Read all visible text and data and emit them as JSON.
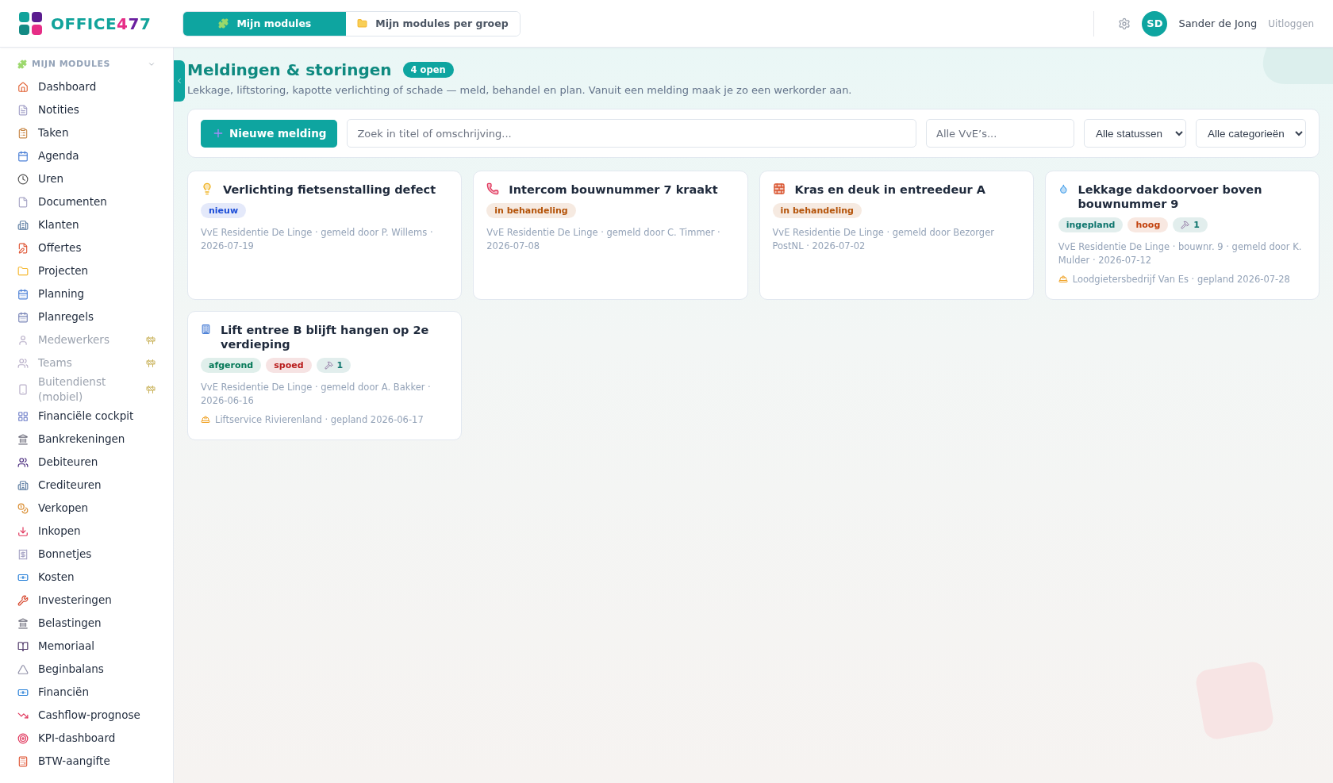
{
  "header": {
    "logo": {
      "parts": [
        {
          "text": "OFFICE",
          "color": "#12a39b"
        },
        {
          "text": "4",
          "color": "#e62d86"
        },
        {
          "text": "7",
          "color": "#6a1fa0"
        },
        {
          "text": "7",
          "color": "#12a39b"
        }
      ]
    },
    "tabs": [
      {
        "label": "Mijn modules",
        "selected": true
      },
      {
        "label": "Mijn modules per groep",
        "selected": false
      }
    ],
    "user": {
      "initials": "SD",
      "name": "Sander de Jong",
      "logout": "Uitloggen"
    }
  },
  "sidebar": {
    "section": "MIJN MODULES",
    "items": [
      {
        "label": "Dashboard",
        "disabled": false
      },
      {
        "label": "Notities",
        "disabled": false
      },
      {
        "label": "Taken",
        "disabled": false
      },
      {
        "label": "Agenda",
        "disabled": false
      },
      {
        "label": "Uren",
        "disabled": false
      },
      {
        "label": "Documenten",
        "disabled": false
      },
      {
        "label": "Klanten",
        "disabled": false
      },
      {
        "label": "Offertes",
        "disabled": false
      },
      {
        "label": "Projecten",
        "disabled": false
      },
      {
        "label": "Planning",
        "disabled": false
      },
      {
        "label": "Planregels",
        "disabled": false
      },
      {
        "label": "Medewerkers",
        "disabled": true
      },
      {
        "label": "Teams",
        "disabled": true
      },
      {
        "label": "Buitendienst (mobiel)",
        "disabled": true
      },
      {
        "label": "Financiële cockpit",
        "disabled": false
      },
      {
        "label": "Bankrekeningen",
        "disabled": false
      },
      {
        "label": "Debiteuren",
        "disabled": false
      },
      {
        "label": "Crediteuren",
        "disabled": false
      },
      {
        "label": "Verkopen",
        "disabled": false
      },
      {
        "label": "Inkopen",
        "disabled": false
      },
      {
        "label": "Bonnetjes",
        "disabled": false
      },
      {
        "label": "Kosten",
        "disabled": false
      },
      {
        "label": "Investeringen",
        "disabled": false
      },
      {
        "label": "Belastingen",
        "disabled": false
      },
      {
        "label": "Memoriaal",
        "disabled": false
      },
      {
        "label": "Beginbalans",
        "disabled": false
      },
      {
        "label": "Financiën",
        "disabled": false
      },
      {
        "label": "Cashflow-prognose",
        "disabled": false
      },
      {
        "label": "KPI-dashboard",
        "disabled": false
      },
      {
        "label": "BTW-aangifte",
        "disabled": false
      }
    ]
  },
  "page": {
    "title": "Meldingen & storingen",
    "badge": "4 open",
    "subtitle": "Lekkage, liftstoring, kapotte verlichting of schade — meld, behandel en plan. Vanuit een melding maak je zo een werkorder aan."
  },
  "filters": {
    "new_button": "Nieuwe melding",
    "search": {
      "placeholder": "Zoek in titel of omschrijving..."
    },
    "vve": {
      "placeholder": "Alle VvE’s..."
    },
    "status": {
      "value": "Alle statussen"
    },
    "category": {
      "value": "Alle categorieën"
    }
  },
  "cards": [
    {
      "kind": "light",
      "title": "Verlichting fietsenstalling defect",
      "tags": [
        {
          "text": "nieuw",
          "color": "#1d4ed8",
          "kind": "text"
        }
      ],
      "meta": "VvE Residentie De Linge · gemeld door P. Willems · 2026-07-19"
    },
    {
      "kind": "phone",
      "title": "Intercom bouwnummer 7 kraakt",
      "tags": [
        {
          "text": "in behandeling",
          "color": "#b45309",
          "kind": "text"
        }
      ],
      "meta": "VvE Residentie De Linge · gemeld door C. Timmer · 2026-07-08"
    },
    {
      "kind": "brick",
      "title": "Kras en deuk in entreedeur A",
      "tags": [
        {
          "text": "in behandeling",
          "color": "#b45309",
          "kind": "text"
        }
      ],
      "meta": "VvE Residentie De Linge · gemeld door Bezorger PostNL · 2026-07-02"
    },
    {
      "kind": "water",
      "title": "Lekkage dakdoorvoer boven bouwnummer 9",
      "tags": [
        {
          "text": "ingepland",
          "color": "#0f766e",
          "kind": "text"
        },
        {
          "text": "hoog",
          "color": "#c2410c",
          "kind": "text"
        },
        {
          "text": "1",
          "color": "#0f766e",
          "kind": "workorders"
        }
      ],
      "meta": "VvE Residentie De Linge · bouwnr. 9 · gemeld door K. Mulder · 2026-07-12",
      "planned": "Loodgietersbedrijf Van Es · gepland 2026-07-28"
    },
    {
      "kind": "lift",
      "title": "Lift entree B blijft hangen op 2e verdieping",
      "tags": [
        {
          "text": "afgerond",
          "color": "#047857",
          "kind": "text"
        },
        {
          "text": "spoed",
          "color": "#b91c1c",
          "kind": "text"
        },
        {
          "text": "1",
          "color": "#0f766e",
          "kind": "workorders"
        }
      ],
      "meta": "VvE Residentie De Linge · gemeld door A. Bakker · 2026-06-16",
      "planned": "Liftservice Rivierenland · gepland 2026-06-17"
    }
  ]
}
